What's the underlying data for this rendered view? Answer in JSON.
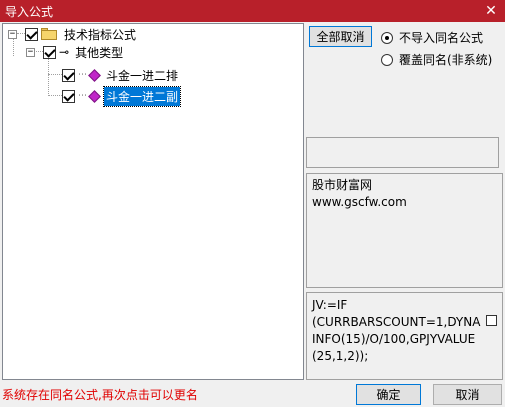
{
  "window": {
    "title": "导入公式",
    "close_glyph": "✕"
  },
  "tree": {
    "root": {
      "label": "技术指标公式",
      "checked": true,
      "expander": "−"
    },
    "group": {
      "label": "其他类型",
      "checked": true,
      "expander": "−"
    },
    "items": [
      {
        "label": "斗金一进二排",
        "checked": true,
        "selected": false
      },
      {
        "label": "斗金一进二副",
        "checked": true,
        "selected": true
      }
    ]
  },
  "options": {
    "deselect_all_label": "全部取消",
    "radio_skip_label": "不导入同名公式",
    "radio_overwrite_label": "覆盖同名(非系统)",
    "selected": "skip"
  },
  "info": {
    "line1": "股市财富网",
    "line2": "www.gscfw.com"
  },
  "formula": {
    "text": "JV:=IF\n(CURRBARSCOUNT=1,DYNA\nINFO(15)/O/100,GPJYVALUE\n(25,1,2));"
  },
  "footer": {
    "status": "系统存在同名公式,再次点击可以更名",
    "ok_label": "确定",
    "cancel_label": "取消"
  },
  "colors": {
    "titlebar": "#b8202a",
    "selection": "#0078d7",
    "status_text": "#e00000"
  }
}
